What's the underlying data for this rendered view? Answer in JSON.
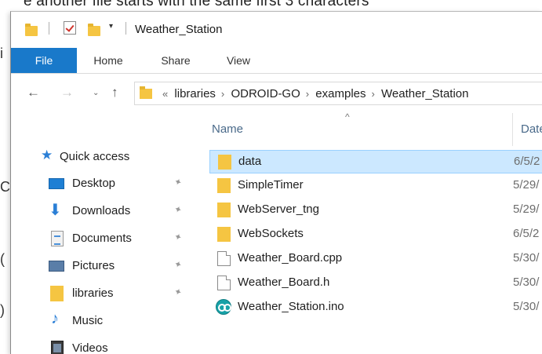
{
  "background": {
    "top_text": "e another file starts with the same first 3 characters",
    "left_fragments": [
      "i",
      "C",
      "(",
      ")"
    ]
  },
  "window": {
    "title": "Weather_Station",
    "dropdown_glyph": "▾"
  },
  "ribbon": {
    "tabs": [
      "File",
      "Home",
      "Share",
      "View"
    ]
  },
  "navigation": {
    "back": "←",
    "forward": "→",
    "recent": "⌄",
    "up": "↑"
  },
  "address": {
    "overflow": "«",
    "separator": "›",
    "crumbs": [
      "libraries",
      "ODROID-GO",
      "examples",
      "Weather_Station"
    ]
  },
  "nav_pane": {
    "quick_access": "Quick access",
    "pin_glyph": "📌",
    "items": [
      {
        "label": "Desktop",
        "icon": "desktop-icon",
        "pinned": true
      },
      {
        "label": "Downloads",
        "icon": "download-icon",
        "pinned": true
      },
      {
        "label": "Documents",
        "icon": "documents-icon",
        "pinned": true
      },
      {
        "label": "Pictures",
        "icon": "pictures-icon",
        "pinned": true
      },
      {
        "label": "libraries",
        "icon": "folder-icon",
        "pinned": true
      },
      {
        "label": "Music",
        "icon": "music-icon",
        "pinned": false
      },
      {
        "label": "Videos",
        "icon": "videos-icon",
        "pinned": false
      }
    ]
  },
  "file_list": {
    "sort_glyph": "^",
    "columns": {
      "name": "Name",
      "date": "Date"
    },
    "rows": [
      {
        "name": "data",
        "date": "6/5/2",
        "type": "folder",
        "selected": true
      },
      {
        "name": "SimpleTimer",
        "date": "5/29/",
        "type": "folder",
        "selected": false
      },
      {
        "name": "WebServer_tng",
        "date": "5/29/",
        "type": "folder",
        "selected": false
      },
      {
        "name": "WebSockets",
        "date": "6/5/2",
        "type": "folder",
        "selected": false
      },
      {
        "name": "Weather_Board.cpp",
        "date": "5/30/",
        "type": "file",
        "selected": false
      },
      {
        "name": "Weather_Board.h",
        "date": "5/30/",
        "type": "file",
        "selected": false
      },
      {
        "name": "Weather_Station.ino",
        "date": "5/30/",
        "type": "arduino",
        "selected": false
      }
    ]
  },
  "colors": {
    "file_tab": "#1979ca",
    "selection": "#cce8ff",
    "folder": "#f5c542",
    "accent": "#2b7fd6"
  }
}
